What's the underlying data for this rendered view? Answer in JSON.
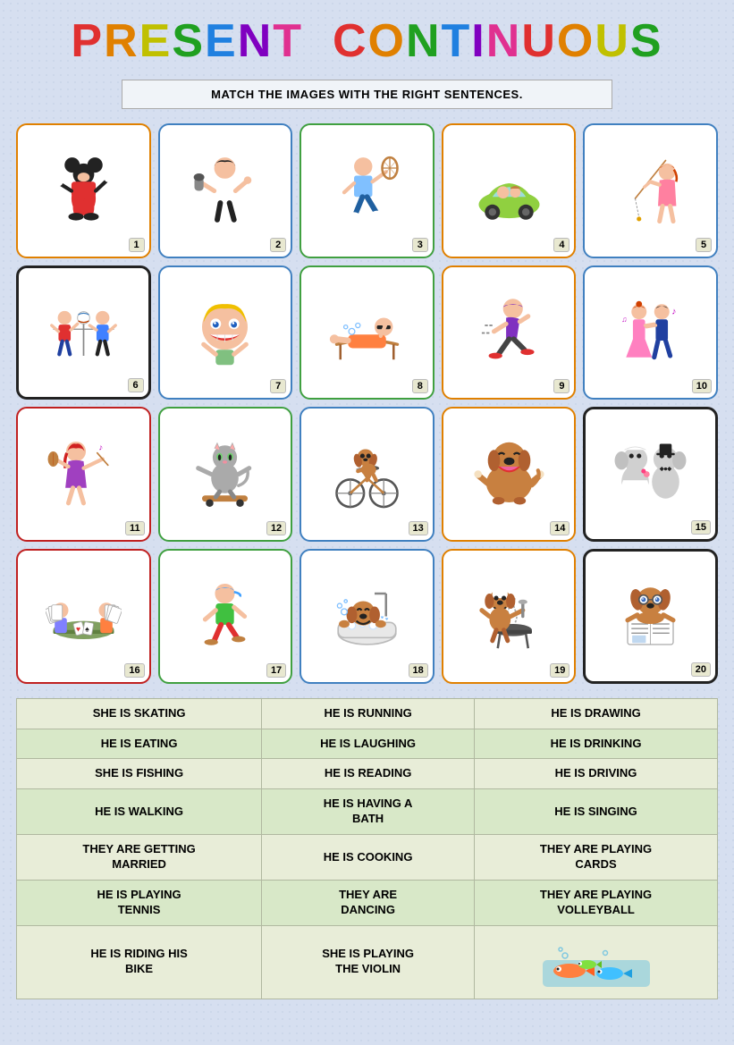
{
  "title": {
    "text": "PRESENT CONTINUOUS",
    "letters": [
      "P",
      "R",
      "E",
      "S",
      "E",
      "N",
      "T",
      " ",
      "C",
      "O",
      "N",
      "T",
      "I",
      "N",
      "U",
      "O",
      "U",
      "S"
    ]
  },
  "instruction": "MATCH THE IMAGES WITH THE RIGHT SENTENCES.",
  "cards": [
    {
      "number": 1,
      "border": "border-orange",
      "description": "mickey mouse dancing",
      "emoji": "🐭"
    },
    {
      "number": 2,
      "border": "border-blue",
      "description": "man singing with microphone",
      "emoji": "🎤"
    },
    {
      "number": 3,
      "border": "border-green",
      "description": "man playing tennis running",
      "emoji": "🎾"
    },
    {
      "number": 4,
      "border": "border-orange",
      "description": "person driving green car",
      "emoji": "🚗"
    },
    {
      "number": 5,
      "border": "border-blue",
      "description": "woman fishing",
      "emoji": "🎣"
    },
    {
      "number": 6,
      "border": "border-black",
      "description": "characters playing volleyball",
      "emoji": "🏐"
    },
    {
      "number": 7,
      "border": "border-blue",
      "description": "boy laughing",
      "emoji": "😂"
    },
    {
      "number": 8,
      "border": "border-green",
      "description": "man having a bath relaxing",
      "emoji": "🛁"
    },
    {
      "number": 9,
      "border": "border-orange",
      "description": "man running",
      "emoji": "🏃"
    },
    {
      "number": 10,
      "border": "border-blue",
      "description": "couple dancing",
      "emoji": "💃"
    },
    {
      "number": 11,
      "border": "border-red",
      "description": "girl playing violin",
      "emoji": "🎻"
    },
    {
      "number": 12,
      "border": "border-green",
      "description": "cat riding bike or skateboard",
      "emoji": "🛹"
    },
    {
      "number": 13,
      "border": "border-blue",
      "description": "dog riding bicycle",
      "emoji": "🚲"
    },
    {
      "number": 14,
      "border": "border-orange",
      "description": "dog eating",
      "emoji": "🍖"
    },
    {
      "number": 15,
      "border": "border-black",
      "description": "couple getting married",
      "emoji": "💒"
    },
    {
      "number": 16,
      "border": "border-red",
      "description": "people playing cards",
      "emoji": "🃏"
    },
    {
      "number": 17,
      "border": "border-green",
      "description": "boy walking",
      "emoji": "🚶"
    },
    {
      "number": 18,
      "border": "border-blue",
      "description": "dog having a bath",
      "emoji": "🐕"
    },
    {
      "number": 19,
      "border": "border-orange",
      "description": "dog cooking at BBQ",
      "emoji": "🍖"
    },
    {
      "number": 20,
      "border": "border-black",
      "description": "dog reading newspaper",
      "emoji": "📰"
    }
  ],
  "sentences": [
    [
      "SHE IS SKATING",
      "HE IS RUNNING",
      "HE IS DRAWING"
    ],
    [
      "HE IS EATING",
      "HE IS LAUGHING",
      "HE IS DRINKING"
    ],
    [
      "SHE IS FISHING",
      "HE IS READING",
      "HE IS DRIVING"
    ],
    [
      "HE IS WALKING",
      "HE IS HAVING A\nBATH",
      "HE IS SINGING"
    ],
    [
      "THEY ARE GETTING\nMARRIED",
      "HE IS COOKING",
      "THEY ARE PLAYING\nCARDS"
    ],
    [
      "HE IS PLAYING\nTENNIS",
      "THEY ARE\nDANCING",
      "THEY ARE PLAYING\nVOLLEYBALL"
    ],
    [
      "HE IS RIDING HIS\nBIKE",
      "SHE IS PLAYING\nTHE VIOLIN",
      "fish_image"
    ]
  ]
}
